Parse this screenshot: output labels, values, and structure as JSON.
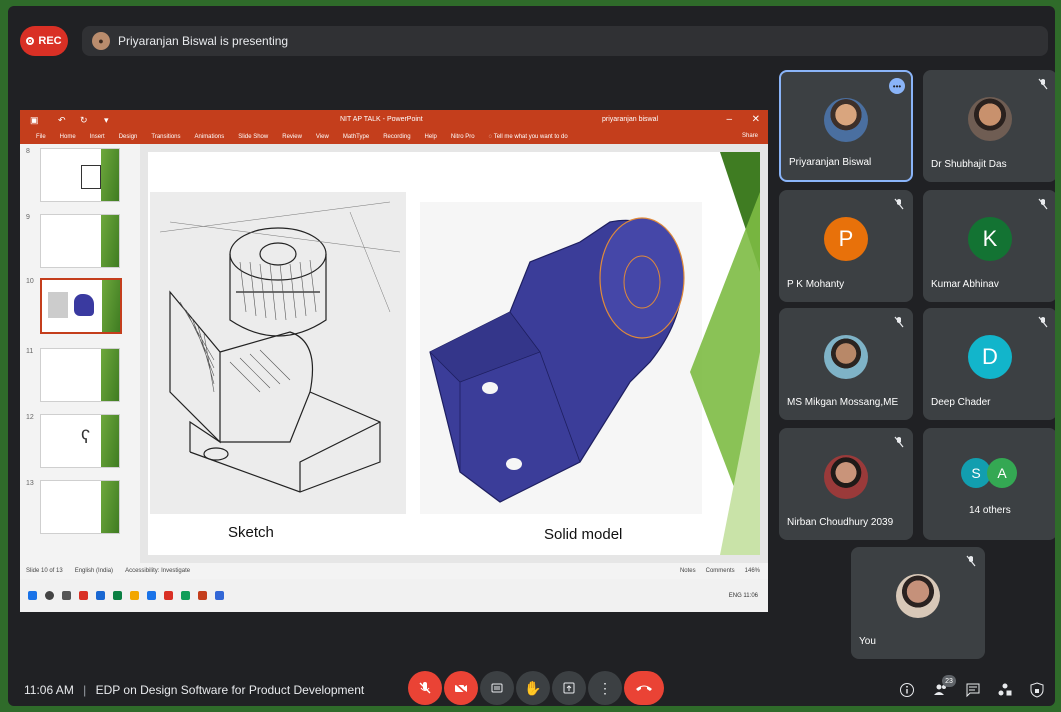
{
  "header": {
    "rec_label": "REC",
    "presenting_text": "Priyaranjan Biswal is presenting"
  },
  "shared_screen": {
    "window_title": "NIT AP TALK - PowerPoint",
    "user": "priyaranjan biswal",
    "ribbon_tabs": [
      "File",
      "Home",
      "Insert",
      "Design",
      "Transitions",
      "Animations",
      "Slide Show",
      "Review",
      "View",
      "MathType",
      "Recording",
      "Help",
      "Nitro Pro"
    ],
    "tell_me": "Tell me what you want to do",
    "share_label": "Share",
    "slide_numbers": [
      "8",
      "9",
      "10",
      "11",
      "12",
      "13"
    ],
    "slide_captions": {
      "left": "Sketch",
      "right": "Solid model"
    },
    "status": {
      "slide_of": "Slide 10 of 13",
      "language": "English (India)",
      "accessibility": "Accessibility: Investigate",
      "notes": "Notes",
      "comments": "Comments",
      "zoom": "146%"
    },
    "taskbar_right": "ENG 11:06"
  },
  "participants": [
    {
      "name": "Priyaranjan Biswal",
      "type": "photo",
      "active": true
    },
    {
      "name": "Dr Shubhajit Das",
      "type": "photo"
    },
    {
      "name": "P K Mohanty",
      "type": "initial",
      "initial": "P",
      "color": "#e8710a"
    },
    {
      "name": "Kumar Abhinav",
      "type": "initial",
      "initial": "K",
      "color": "#137333"
    },
    {
      "name": "MS Mikgan Mossang,ME",
      "type": "photo"
    },
    {
      "name": "Deep Chader",
      "type": "initial",
      "initial": "D",
      "color": "#12b5cb"
    },
    {
      "name": "Nirban Choudhury 2039",
      "type": "photo"
    },
    {
      "name": "14 others",
      "type": "others",
      "initials": [
        "S",
        "A"
      ],
      "colors": [
        "#129eaf",
        "#34a853"
      ]
    },
    {
      "name": "You",
      "type": "photo"
    }
  ],
  "bottom_bar": {
    "time": "11:06 AM",
    "meeting_title": "EDP on Design Software for Product Development",
    "people_count": "23"
  }
}
